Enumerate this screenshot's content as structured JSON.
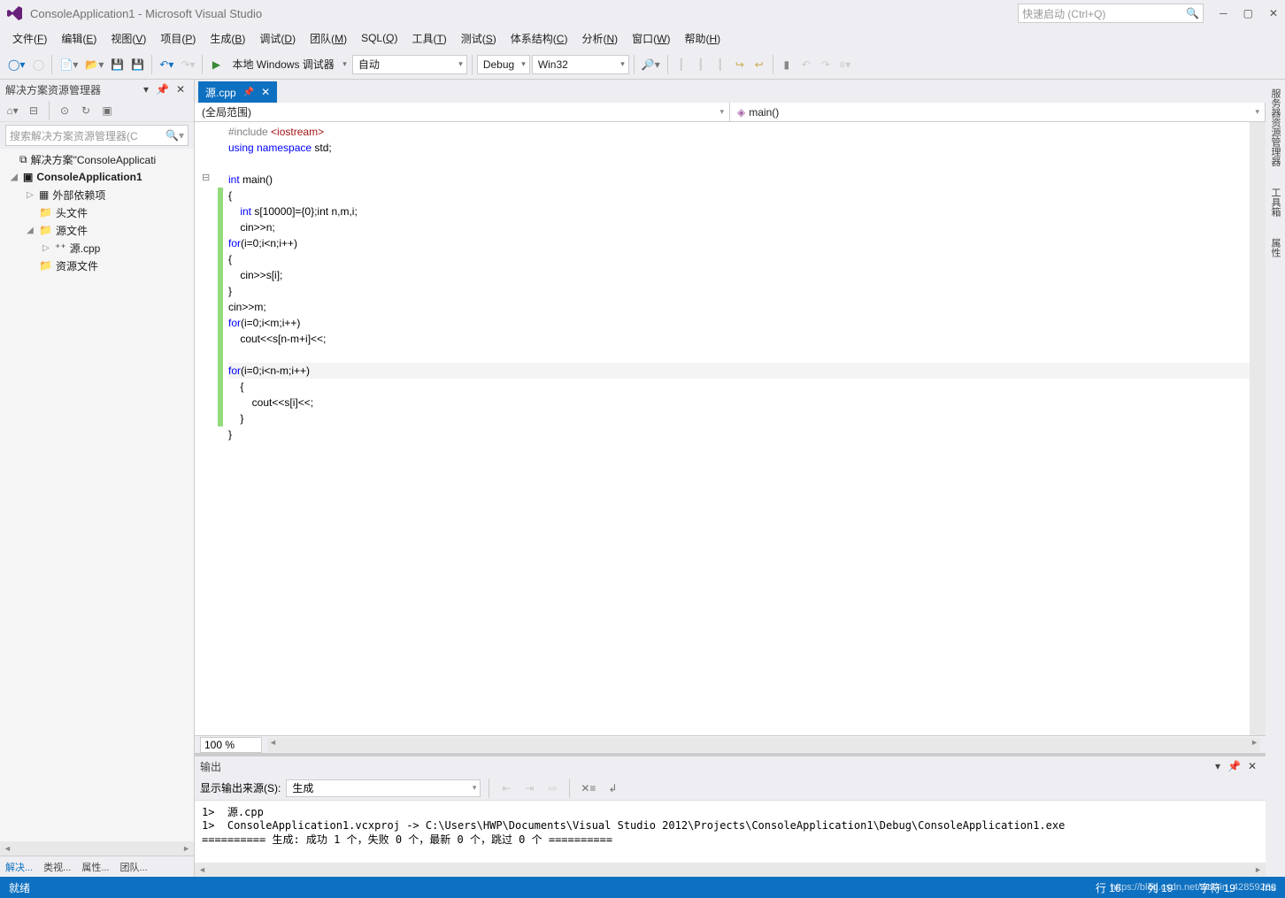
{
  "title": "ConsoleApplication1 - Microsoft Visual Studio",
  "quick_launch_placeholder": "快速启动 (Ctrl+Q)",
  "menu": [
    "文件(F)",
    "编辑(E)",
    "视图(V)",
    "项目(P)",
    "生成(B)",
    "调试(D)",
    "团队(M)",
    "SQL(Q)",
    "工具(T)",
    "测试(S)",
    "体系结构(C)",
    "分析(N)",
    "窗口(W)",
    "帮助(H)"
  ],
  "toolbar": {
    "debugger_label": "本地 Windows 调试器",
    "config_auto": "自动",
    "config_debug": "Debug",
    "config_platform": "Win32"
  },
  "solution_explorer": {
    "title": "解决方案资源管理器",
    "search_placeholder": "搜索解决方案资源管理器(C",
    "root": "解决方案\"ConsoleApplicati",
    "project": "ConsoleApplication1",
    "nodes": {
      "external": "外部依赖项",
      "headers": "头文件",
      "sources": "源文件",
      "source_file": "源.cpp",
      "resources": "资源文件"
    },
    "bottom_tabs": [
      "解决...",
      "类视...",
      "属性...",
      "团队..."
    ]
  },
  "doc_tab": "源.cpp",
  "nav_scope": "(全局范围)",
  "nav_func": "main()",
  "code_lines": [
    {
      "t": "#include <iostream>",
      "cls": "inc"
    },
    {
      "t": "using namespace std;",
      "kw": [
        "using",
        "namespace"
      ]
    },
    {
      "t": ""
    },
    {
      "t": "int main()",
      "kw": [
        "int"
      ],
      "fold": "-"
    },
    {
      "t": "{",
      "mark": true
    },
    {
      "t": "    int s[10000]={0};int n,m,i;",
      "kw": [
        "int",
        "int"
      ],
      "mark": true
    },
    {
      "t": "    cin>>n;",
      "mark": true
    },
    {
      "t": "for(i=0;i<n;i++)",
      "kw": [
        "for"
      ],
      "mark": true
    },
    {
      "t": "{",
      "mark": true
    },
    {
      "t": "    cin>>s[i];",
      "mark": true
    },
    {
      "t": "}",
      "mark": true
    },
    {
      "t": "cin>>m;",
      "mark": true
    },
    {
      "t": "for(i=0;i<m;i++)",
      "kw": [
        "for"
      ],
      "mark": true
    },
    {
      "t": "    cout<<s[n-m+i]<<\" \";",
      "mark": true,
      "str": "\" \""
    },
    {
      "t": "",
      "mark": true
    },
    {
      "t": "for(i=0;i<n-m;i++)",
      "kw": [
        "for"
      ],
      "hl": true,
      "mark": true
    },
    {
      "t": "    {",
      "mark": true
    },
    {
      "t": "        cout<<s[i]<<\" \";",
      "mark": true,
      "str": "\" \""
    },
    {
      "t": "    }",
      "mark": true
    },
    {
      "t": "}"
    }
  ],
  "zoom": "100 %",
  "output": {
    "title": "输出",
    "source_label": "显示输出来源(S):",
    "source_value": "生成",
    "lines": [
      "1>  源.cpp",
      "1>  ConsoleApplication1.vcxproj -> C:\\Users\\HWP\\Documents\\Visual Studio 2012\\Projects\\ConsoleApplication1\\Debug\\ConsoleApplication1.exe",
      "========== 生成: 成功 1 个，失败 0 个，最新 0 个，跳过 0 个 =========="
    ]
  },
  "right_tabs": [
    "服务器资源管理器",
    "工具箱",
    "属性"
  ],
  "status": {
    "ready": "就绪",
    "line": "行 16",
    "col": "列 19",
    "char": "字符 19",
    "ins": "Ins",
    "watermark": "https://blog.csdn.net/weixin_42859280"
  }
}
